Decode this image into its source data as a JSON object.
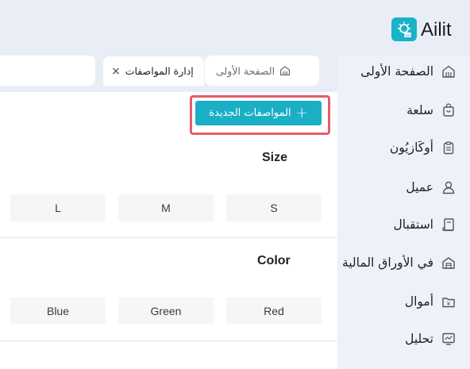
{
  "app": {
    "brand": "Ailit",
    "logo_badge": "mall",
    "accent_color": "#1bafc6"
  },
  "sidebar": {
    "items": [
      {
        "label": "الصفحة الأولى",
        "icon": "home-icon"
      },
      {
        "label": "سلعة",
        "icon": "shopping-bag-icon"
      },
      {
        "label": "أوكَازيُون",
        "icon": "clipboard-icon"
      },
      {
        "label": "عميل",
        "icon": "user-icon"
      },
      {
        "label": "استقبال",
        "icon": "receipt-icon"
      },
      {
        "label": "في الأوراق المالية",
        "icon": "warehouse-icon"
      },
      {
        "label": "أموال",
        "icon": "wallet-icon"
      },
      {
        "label": "تحليل",
        "icon": "chart-monitor-icon"
      }
    ]
  },
  "tabs": {
    "home_label": "الصفحة الأولى",
    "active_label": "إدارة المواصفات"
  },
  "toolbar": {
    "add_label": "المواصفات الجديدة"
  },
  "specs": [
    {
      "title": "Size",
      "values": [
        "S",
        "M",
        "L"
      ]
    },
    {
      "title": "Color",
      "values": [
        "Red",
        "Green",
        "Blue"
      ]
    }
  ],
  "highlight_color": "#e35d6a"
}
